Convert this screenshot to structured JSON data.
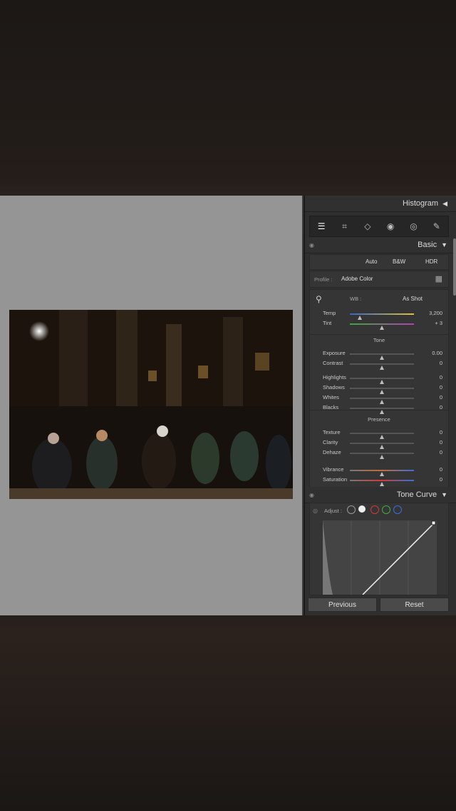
{
  "panel": {
    "histogram_label": "Histogram",
    "basic_label": "Basic",
    "auto": "Auto",
    "bw": "B&W",
    "hdr": "HDR",
    "profile_label": "Profile :",
    "profile_value": "Adobe Color",
    "wb_label": "WB :",
    "wb_value": "As Shot",
    "temp": {
      "label": "Temp",
      "value": "3,200",
      "level": 0.15
    },
    "tint": {
      "label": "Tint",
      "value": "+ 3",
      "level": 0.5
    },
    "tone_group": "Tone",
    "tone": [
      {
        "label": "Exposure",
        "value": "0.00",
        "level": 0.5
      },
      {
        "label": "Contrast",
        "value": "0",
        "level": 0.5
      },
      {
        "label": "Highlights",
        "value": "0",
        "level": 0.5
      },
      {
        "label": "Shadows",
        "value": "0",
        "level": 0.5
      },
      {
        "label": "Whites",
        "value": "0",
        "level": 0.5
      },
      {
        "label": "Blacks",
        "value": "0",
        "level": 0.5
      }
    ],
    "presence_group": "Presence",
    "presence": [
      {
        "label": "Texture",
        "value": "0",
        "level": 0.5
      },
      {
        "label": "Clarity",
        "value": "0",
        "level": 0.5
      },
      {
        "label": "Dehaze",
        "value": "0",
        "level": 0.5
      },
      {
        "label": "Vibrance",
        "value": "0",
        "level": 0.5
      },
      {
        "label": "Saturation",
        "value": "0",
        "level": 0.5
      }
    ],
    "tone_curve_label": "Tone Curve",
    "adjust_label": "Adjust :",
    "previous": "Previous",
    "reset": "Reset"
  },
  "colors": {
    "panel": "#2f2f2f",
    "canvas": "#959595",
    "accent_red": "#d13a3a",
    "accent_green": "#3fae3f",
    "accent_blue": "#3a6fd8"
  }
}
